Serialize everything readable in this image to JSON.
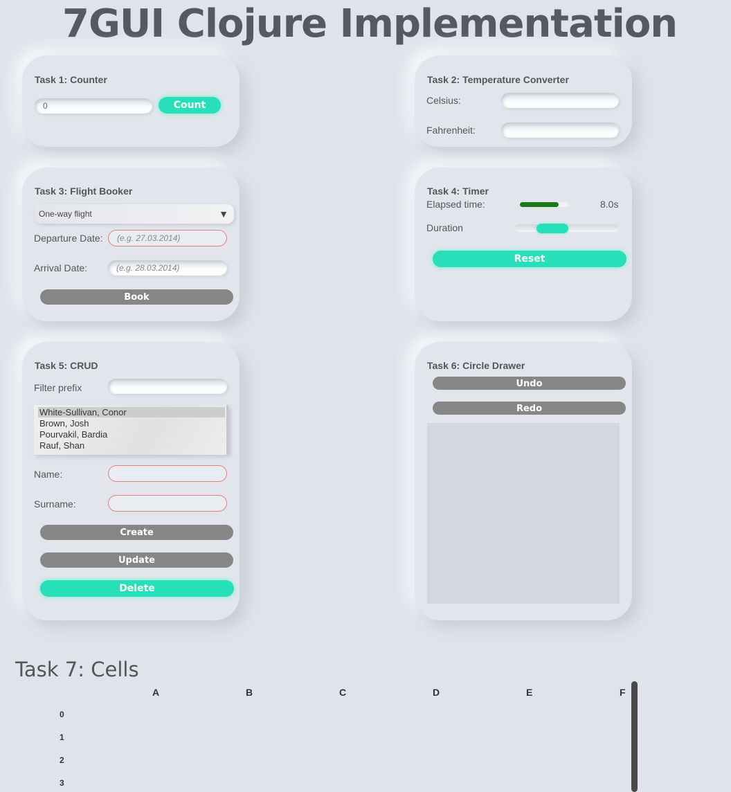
{
  "page_title": "7GUI Clojure Implementation",
  "colors": {
    "accent": "#27dfb8",
    "neutral_button": "#868686",
    "error_border": "#e8807b",
    "progress": "#1a7a1a"
  },
  "task1": {
    "title": "Task 1: Counter",
    "value": "0",
    "button": "Count"
  },
  "task2": {
    "title": "Task 2: Temperature Converter",
    "celsius_label": "Celsius:",
    "fahrenheit_label": "Fahrenheit:",
    "celsius_value": "",
    "fahrenheit_value": ""
  },
  "task3": {
    "title": "Task 3: Flight Booker",
    "flight_type": "One-way flight",
    "departure_label": "Departure Date:",
    "departure_placeholder": "(e.g. 27.03.2014)",
    "arrival_label": "Arrival Date:",
    "arrival_placeholder": "(e.g. 28.03.2014)",
    "book_button": "Book"
  },
  "task4": {
    "title": "Task 4: Timer",
    "elapsed_label": "Elapsed time:",
    "elapsed_value": "8.0s",
    "progress_fraction": 0.8,
    "duration_label": "Duration",
    "duration_fraction": 0.2,
    "reset_button": "Reset"
  },
  "task5": {
    "title": "Task 5: CRUD",
    "filter_label": "Filter prefix",
    "filter_value": "",
    "entries": [
      "White-Sullivan, Conor",
      "Brown, Josh",
      "Pourvakil, Bardia",
      "Rauf, Shan"
    ],
    "selected_entry": "White-Sullivan, Conor",
    "name_label": "Name:",
    "surname_label": "Surname:",
    "create_button": "Create",
    "update_button": "Update",
    "delete_button": "Delete"
  },
  "task6": {
    "title": "Task 6: Circle Drawer",
    "undo_button": "Undo",
    "redo_button": "Redo"
  },
  "task7": {
    "title": "Task 7: Cells",
    "columns": [
      "A",
      "B",
      "C",
      "D",
      "E",
      "F"
    ],
    "rows": [
      "0",
      "1",
      "2",
      "3"
    ]
  }
}
